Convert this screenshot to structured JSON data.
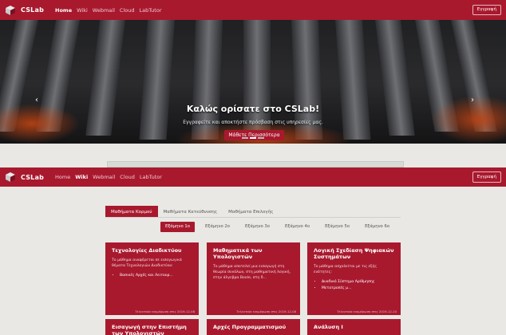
{
  "navbar": {
    "brand": "CSLab",
    "links": [
      "Home",
      "Wiki",
      "Webmail",
      "Cloud",
      "LabTutor"
    ],
    "signup": "Εγγραφή"
  },
  "hero": {
    "title": "Καλώς ορίσατε στο CSLab!",
    "subtitle": "Εγγραφείτε και αποκτήστε πρόσβαση στις υπηρεσίες μας.",
    "button": "Μάθετε Περισσότερα",
    "prev": "‹",
    "next": "›"
  },
  "navbar2": {
    "brand": "CSLab",
    "links": [
      "Home",
      "Wiki",
      "Webmail",
      "Cloud",
      "LabTutor"
    ],
    "signup": "Εγγραφή"
  },
  "tabs": [
    "Μαθήματα Κορμού",
    "Μαθήματα Κατεύθυνσης",
    "Μαθήματα Επιλογής"
  ],
  "semesters": [
    "Εξάμηνο 1ο",
    "Εξάμηνο 2ο",
    "Εξάμηνο 3ο",
    "Εξάμηνο 4ο",
    "Εξάμηνο 5ο",
    "Εξάμηνο 6ο"
  ],
  "cards": [
    {
      "title": "Τεχνολογίες Διαδικτύου",
      "desc": "Το μάθημα αναφέρεται σε εισαγωγικά θέματα Τεχνολογιών Διαδικτύου:",
      "items": [
        "Βασικές Αρχές και Λειτουρ..."
      ],
      "date": "Τελευταία ενημέρωση στις 2019-12-08"
    },
    {
      "title": "Μαθηματικά των Υπολογιστών",
      "desc": "Το μάθημα αποτελεί μια εισαγωγή στη θεωρία συνόλων, στη μαθηματική λογική, στην άλγεβρα Boole, στη δ...",
      "items": [],
      "date": "Τελευταία ενημέρωση στις 2019-12-08"
    },
    {
      "title": "Λογική Σχεδίαση Ψηφιακών Συστημάτων",
      "desc": "Το μάθημα ασχολείται με τις εξής ενότητες:",
      "items": [
        "Δυαδικό Σύστημα Αρίθμησης",
        "Μετατροπές μ..."
      ],
      "date": "Τελευταία ενημέρωση στις 2019-12-10"
    },
    {
      "title": "Εισαγωγή στην Επιστήμη των Υπολογιστών",
      "desc": "",
      "items": [],
      "date": ""
    },
    {
      "title": "Αρχές Προγραμματισμού",
      "desc": "",
      "items": [],
      "date": ""
    },
    {
      "title": "Ανάλυση Ι",
      "desc": "",
      "items": [],
      "date": ""
    }
  ]
}
